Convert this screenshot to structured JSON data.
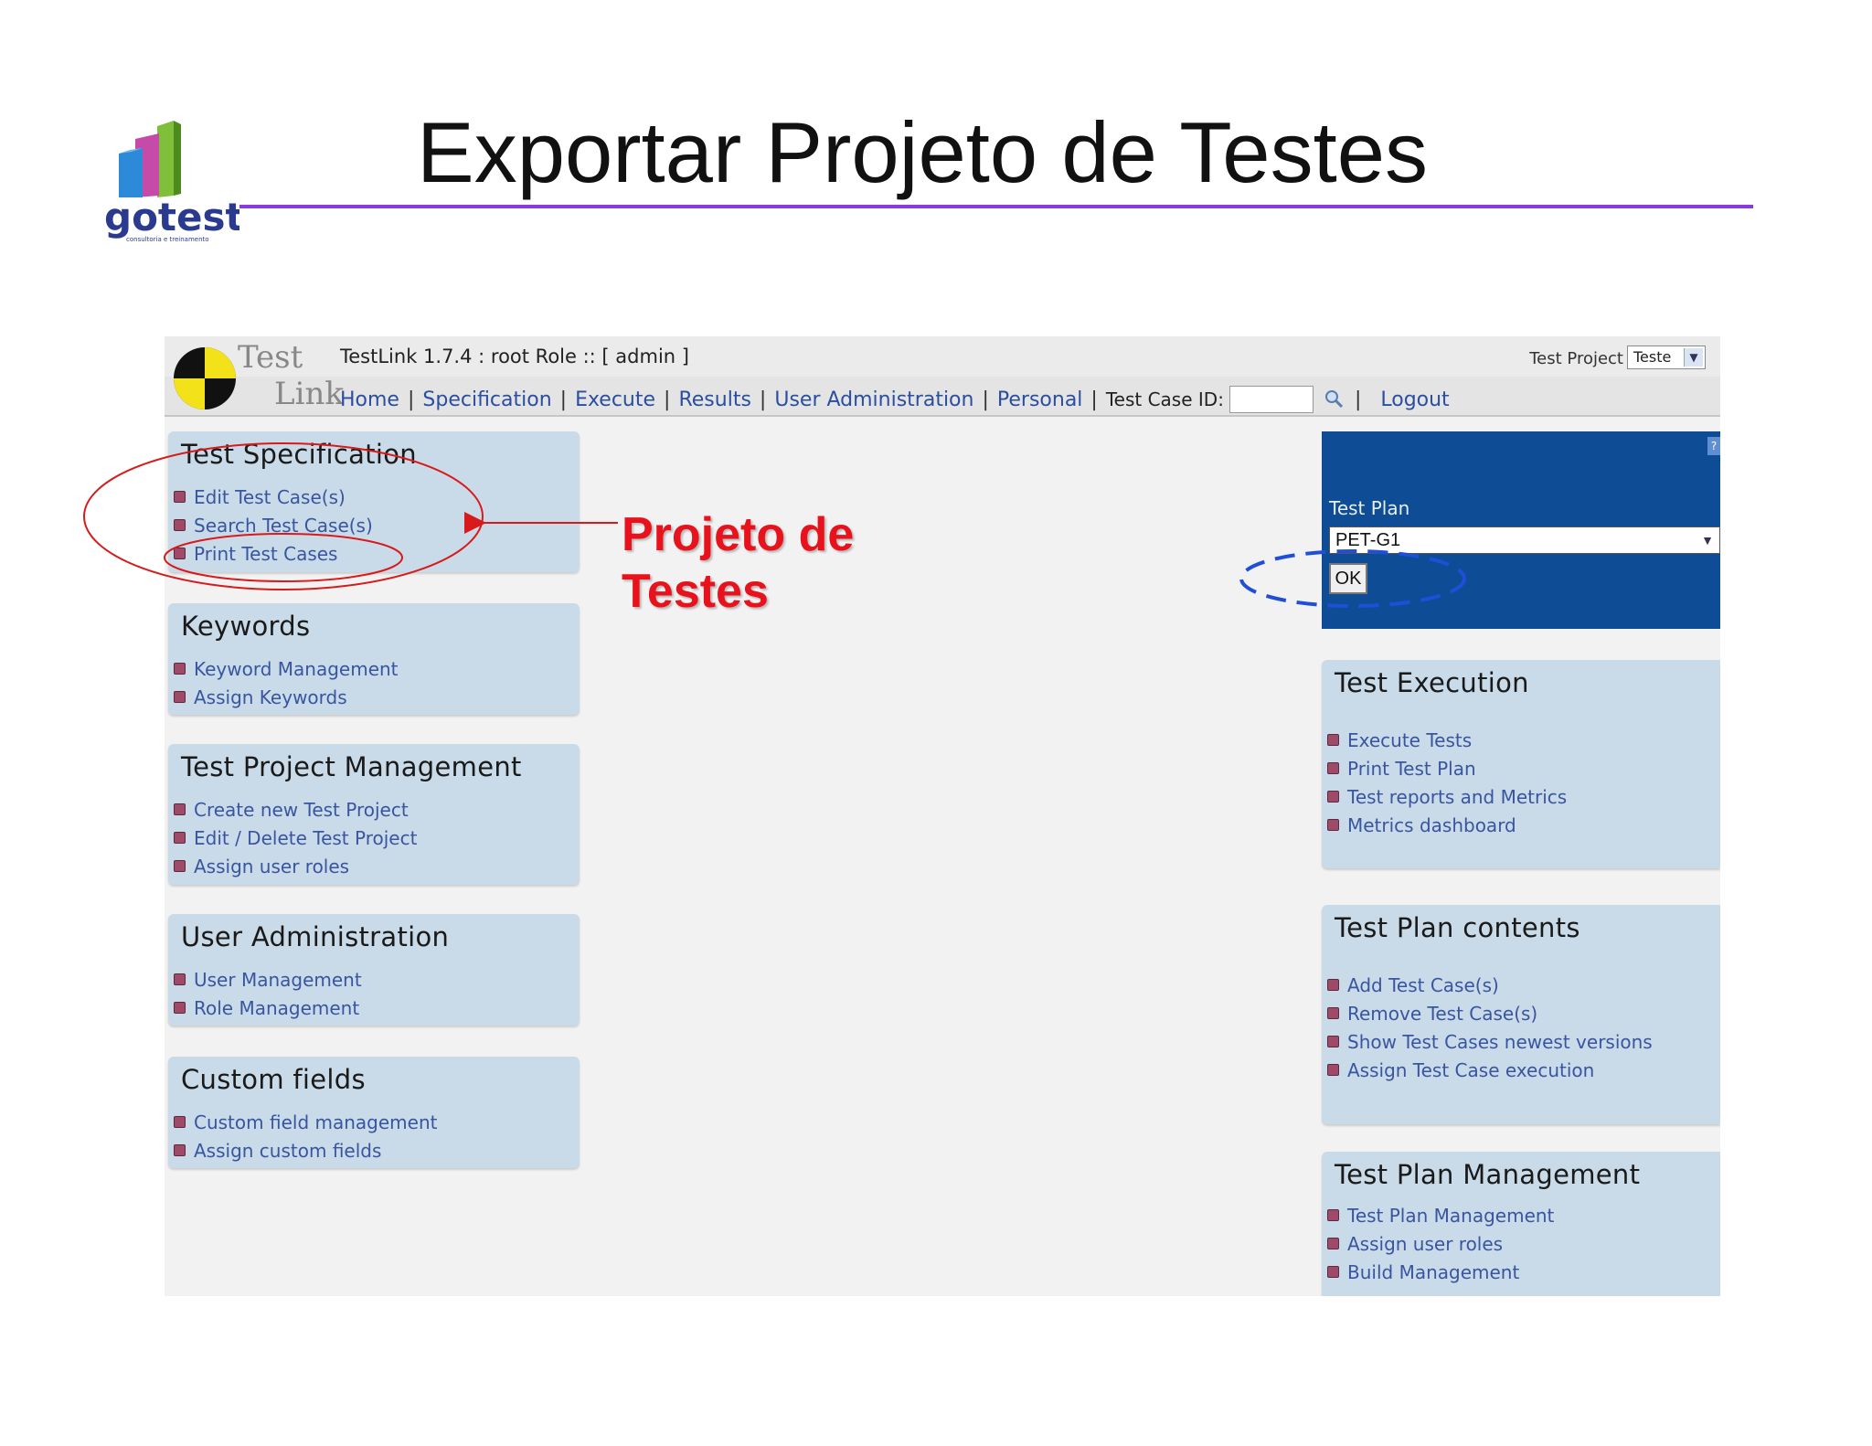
{
  "slide": {
    "title": "Exportar Projeto de Testes",
    "logo_text": "gotest",
    "logo_tagline": "consultoria e treinamento",
    "accent_color": "#8a3be0"
  },
  "app": {
    "logo_line1": "Test",
    "logo_line2": "Link",
    "version_text": "TestLink 1.7.4 : root Role :: [ admin ]",
    "project_label": "Test Project",
    "project_value": "Teste",
    "nav": {
      "home": "Home",
      "specification": "Specification",
      "execute": "Execute",
      "results": "Results",
      "user_admin": "User Administration",
      "personal": "Personal",
      "tcid_label": "Test Case ID:",
      "logout": "Logout",
      "separator": "|"
    }
  },
  "left_boxes": [
    {
      "title": "Test Specification",
      "items": [
        "Edit Test Case(s)",
        "Search Test Case(s)",
        "Print Test Cases"
      ]
    },
    {
      "title": "Keywords",
      "items": [
        "Keyword Management",
        "Assign Keywords"
      ]
    },
    {
      "title": "Test Project Management",
      "items": [
        "Create new Test Project",
        "Edit / Delete Test Project",
        "Assign user roles"
      ]
    },
    {
      "title": "User Administration",
      "items": [
        "User Management",
        "Role Management"
      ]
    },
    {
      "title": "Custom fields",
      "items": [
        "Custom field management",
        "Assign custom fields"
      ]
    }
  ],
  "test_plan": {
    "label": "Test Plan",
    "selected": "PET-G1",
    "ok_label": "OK",
    "help": "?"
  },
  "right_boxes": [
    {
      "title": "Test Execution",
      "items": [
        "Execute Tests",
        "Print Test Plan",
        "Test reports and Metrics",
        "Metrics dashboard"
      ]
    },
    {
      "title": "Test Plan contents",
      "items": [
        "Add Test Case(s)",
        "Remove Test Case(s)",
        "Show Test Cases newest versions",
        "Assign Test Case execution"
      ]
    },
    {
      "title": "Test Plan Management",
      "items": [
        "Test Plan Management",
        "Assign user roles",
        "Build Management"
      ]
    }
  ],
  "annotation": {
    "line1": "Projeto de",
    "line2": "Testes",
    "color": "#e8121c",
    "circle_color": "#d81a1a",
    "dashed_color": "#1f4fd8"
  }
}
